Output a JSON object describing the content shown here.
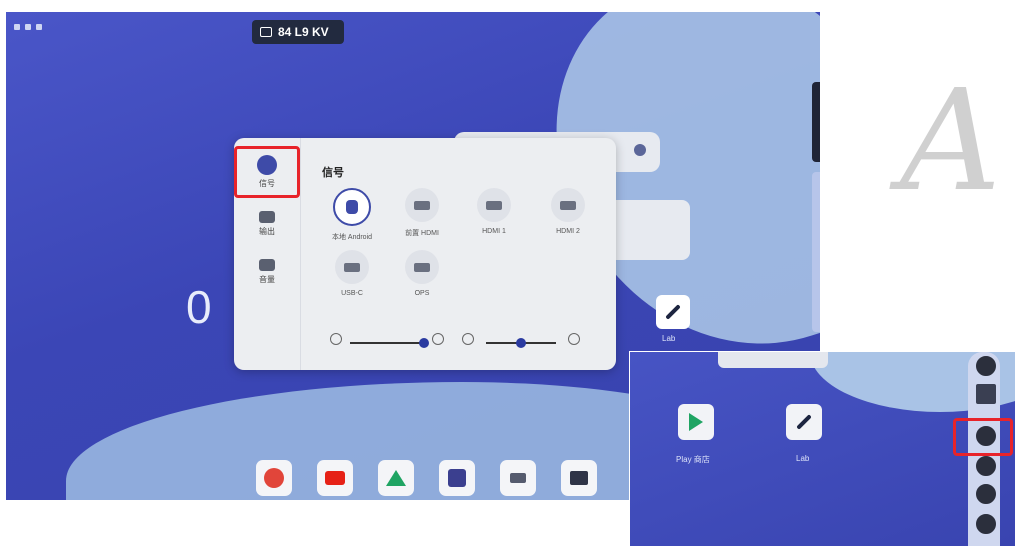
{
  "status_bar": {
    "device_name": "84 L9 KV"
  },
  "home": {
    "clock_partial": "0"
  },
  "input_panel": {
    "title": "信号",
    "sidebar": [
      {
        "label": "信号",
        "icon": "signal-source-icon",
        "active": true
      },
      {
        "label": "输出",
        "icon": "display-icon",
        "active": false
      },
      {
        "label": "音量",
        "icon": "volume-icon",
        "active": false
      }
    ],
    "sources": [
      {
        "label": "本地 Android",
        "icon": "android-icon",
        "selected": true
      },
      {
        "label": "前置 HDMI",
        "icon": "hdmi-icon",
        "selected": false
      },
      {
        "label": "HDMI 1",
        "icon": "hdmi-icon",
        "selected": false
      },
      {
        "label": "HDMI 2",
        "icon": "hdmi-icon",
        "selected": false
      },
      {
        "label": "USB-C",
        "icon": "usbc-icon",
        "selected": false
      },
      {
        "label": "OPS",
        "icon": "ops-icon",
        "selected": false
      }
    ],
    "brightness_level": 0.95,
    "volume_level": 0.5
  },
  "home_shortcut": {
    "label": "Lab"
  },
  "dock": [
    {
      "name": "chrome-icon",
      "color": "#e1453a"
    },
    {
      "name": "youtube-icon",
      "color": "#e62117"
    },
    {
      "name": "drive-icon",
      "color": "#1fa463"
    },
    {
      "name": "whiteboard-icon",
      "color": "#3b3f8f"
    },
    {
      "name": "cast-icon",
      "color": "#555b6e"
    },
    {
      "name": "files-icon",
      "color": "#2f3447"
    }
  ],
  "inset": {
    "apps": [
      {
        "label": "Play 商店",
        "icon": "play-store-icon"
      },
      {
        "label": "Lab",
        "icon": "pen-icon"
      }
    ],
    "rail_buttons": [
      "chrome-icon",
      "grid-icon",
      "input-source-icon",
      "pen-icon",
      "layout-icon",
      "settings-icon"
    ]
  },
  "accent_color": "#e8232a"
}
